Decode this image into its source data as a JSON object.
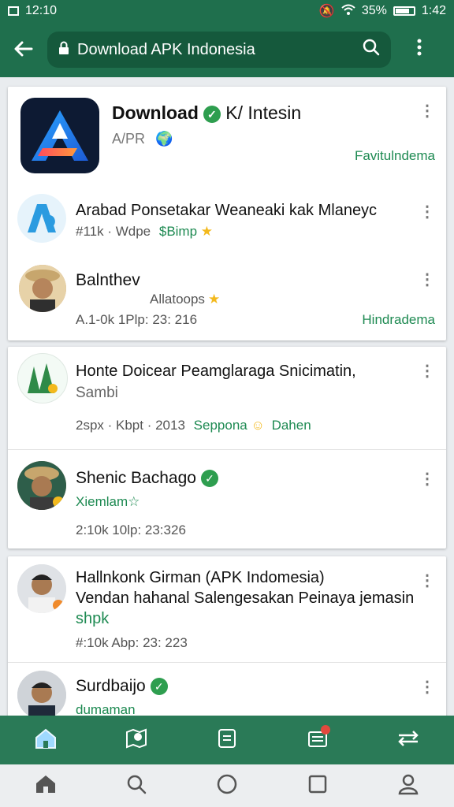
{
  "status_bar": {
    "time": "12:10",
    "battery_text": "35%",
    "clock_right": "1:42"
  },
  "app_bar": {
    "title": "Download APK Indonesia"
  },
  "items": [
    {
      "title": "Download",
      "title_tail": "K/ Intesin",
      "subtitle": "A/PR",
      "meta_right": "Favitulndema"
    },
    {
      "title": "Arabad Ponsetakar Weaneaki kak Mlaneyc",
      "meta": "#11k · Wdpe",
      "meta_green": "$Bimp"
    },
    {
      "title": "Balnthev",
      "sub": "Allatoops",
      "meta": "A.1-0k 1Plp: 23: 216",
      "meta_right": "Hindradema"
    },
    {
      "title": "Honte Doicear Peamglaraga Snicimatin,",
      "sub": "Sambi",
      "meta": "2spx · Kbpt · 2013",
      "meta_green": "Seppona",
      "meta_tail": "Dahen"
    },
    {
      "title": "Shenic Bachago",
      "sub": "Xiemlam",
      "meta": "2:10k 10lp: 23:326"
    },
    {
      "title": "Hallnkonk Girman (APK Indomesia)",
      "line2": "Vendan hahanal Salengesakan Peinaya jemasin",
      "line3": "shpk",
      "meta": "#:10k Abp: 23: 223"
    },
    {
      "title": "Surdbaijo",
      "sub": "dumaman"
    }
  ]
}
